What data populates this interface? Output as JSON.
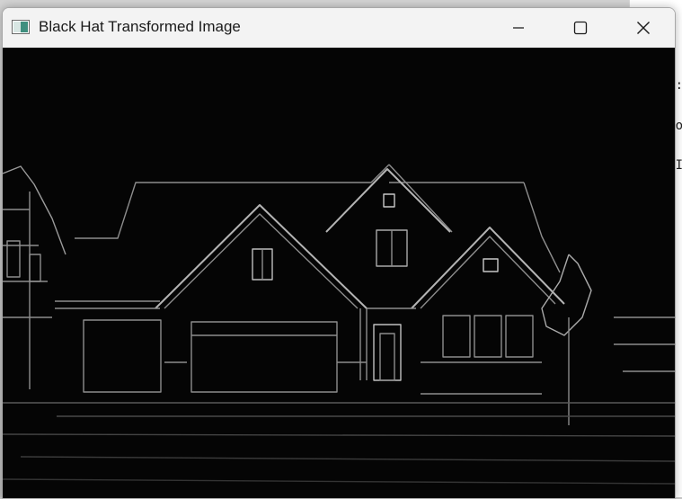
{
  "window": {
    "title": "Black Hat Transformed Image",
    "icons": {
      "app": "image-window-icon",
      "minimize": "minimize-icon",
      "maximize": "maximize-icon",
      "close": "close-icon"
    }
  },
  "image": {
    "subject": "house outline",
    "effect": "black hat transform"
  },
  "background_window": {
    "glyphs": [
      ":",
      "o",
      "I"
    ]
  },
  "colors": {
    "titlebar": "#f3f3f3",
    "image_background": "#050505",
    "edges": "#9a9a9a"
  }
}
